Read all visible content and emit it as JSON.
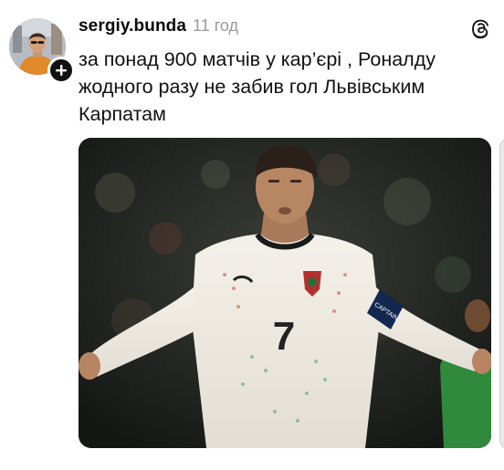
{
  "post": {
    "author": {
      "username": "sergiy.bunda",
      "avatar_icon": "user-avatar",
      "follow_icon": "plus-icon"
    },
    "timestamp": "11 год",
    "app_icon": "threads-logo-icon",
    "text": "за понад 900 матчів у кар’єрі , Роналду жодного разу не забив гол Львівським Карпатам",
    "image": {
      "jersey_number": "7",
      "armband_text": "CAPTAIN"
    }
  },
  "colors": {
    "background": "#ffffff",
    "username": "#0a0a0a",
    "timestamp": "#9a9a9a",
    "text": "#111111",
    "badge": "#111111"
  }
}
